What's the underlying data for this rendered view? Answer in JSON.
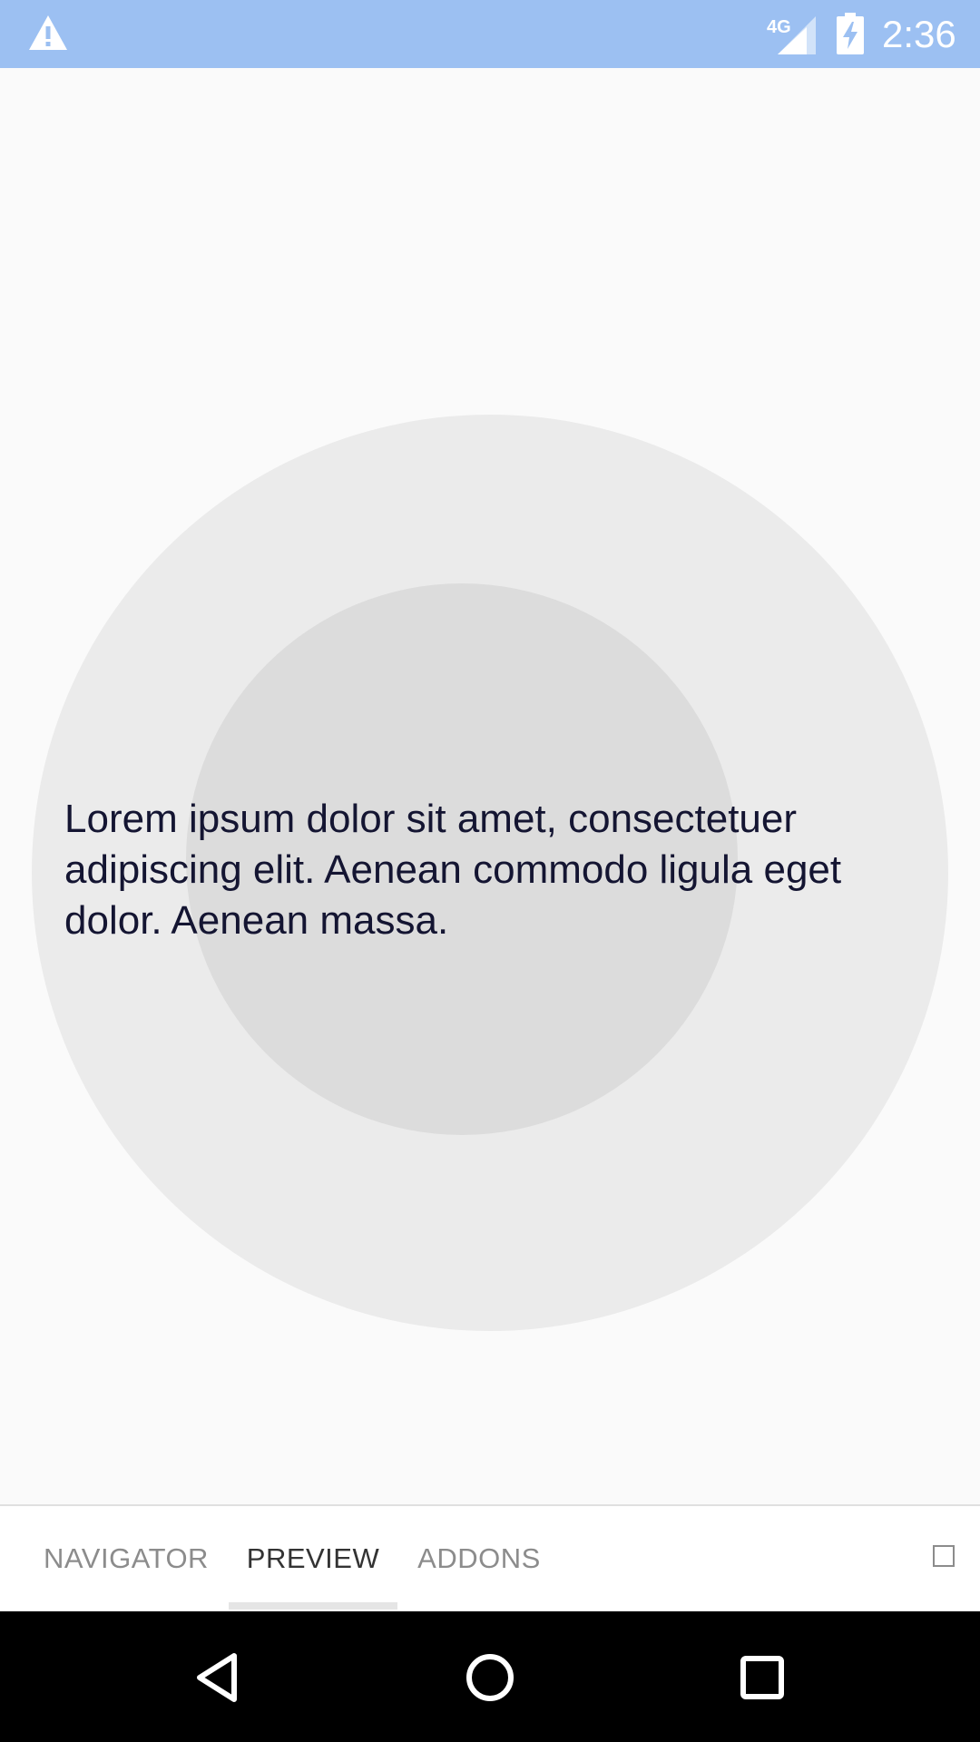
{
  "status_bar": {
    "time": "2:36",
    "network_label": "4G",
    "background_color": "#9cc0f2",
    "icons": [
      "warning-icon",
      "signal-icon",
      "battery-charging-icon"
    ]
  },
  "content": {
    "text": "Lorem ipsum dolor sit amet, consectetuer adipiscing elit. Aenean commodo ligula eget dolor. Aenean massa.",
    "text_color": "#141532",
    "outer_circle_color": "#ebebeb",
    "inner_circle_color": "#dcdcdc"
  },
  "tabs": [
    {
      "label": "NAVIGATOR",
      "active": false
    },
    {
      "label": "PREVIEW",
      "active": true
    },
    {
      "label": "ADDONS",
      "active": false
    }
  ],
  "nav_bar": {
    "icons": [
      "back-icon",
      "home-icon",
      "recents-icon"
    ]
  }
}
